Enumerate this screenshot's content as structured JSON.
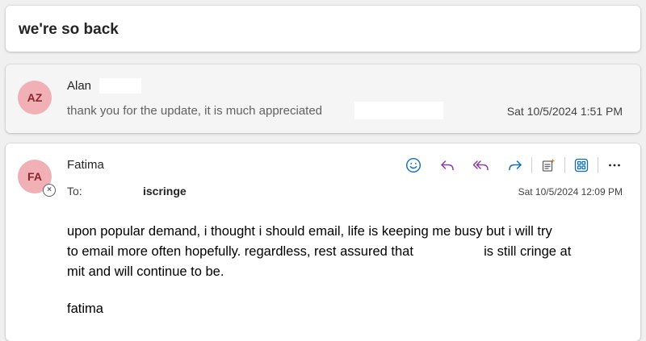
{
  "thread": {
    "subject": "we're so back"
  },
  "messages": [
    {
      "initials": "AZ",
      "sender": "Alan",
      "preview": "thank you for the update, it is much appreciated",
      "date": "Sat 10/5/2024 1:51 PM",
      "avatar_color": "#f1b0b5"
    },
    {
      "initials": "FA",
      "sender": "Fatima",
      "to_label": "To:",
      "recipient": "iscringe",
      "date": "Sat 10/5/2024 12:09 PM",
      "avatar_color": "#f1b0b5",
      "body": {
        "line1": "upon popular demand, i thought i should email, life is keeping me busy but i will try",
        "line2a": "to email more often hopefully. regardless, rest assured that",
        "line2b": "is still cringe at",
        "line3": "mit and will continue to be.",
        "signature": "fatima"
      }
    }
  ],
  "toolbar": {
    "icons": [
      "smiley-icon",
      "reply-icon",
      "reply-all-icon",
      "forward-icon",
      "summary-icon",
      "apps-icon",
      "more-icon"
    ],
    "accent": "#0f6cbd",
    "reply_all_color": "#8b3ba6"
  }
}
